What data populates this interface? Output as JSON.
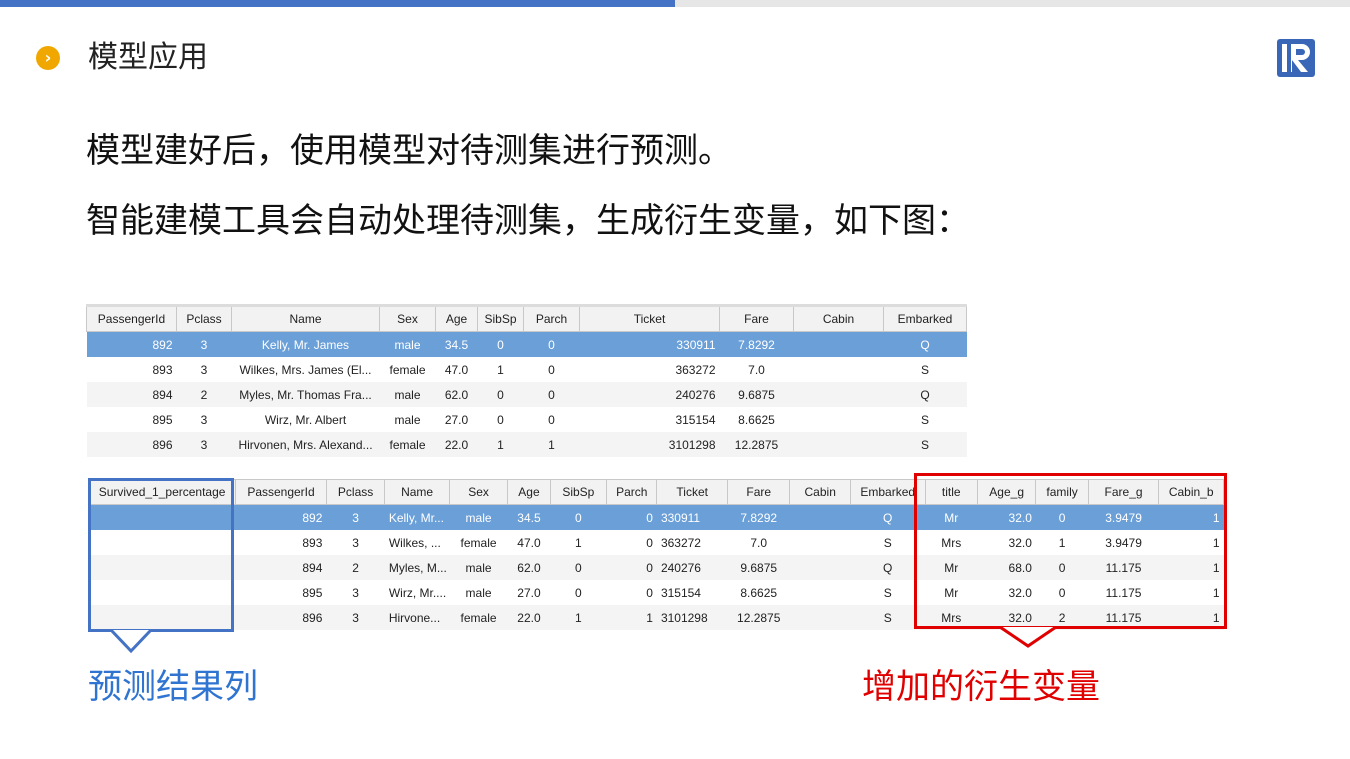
{
  "header": {
    "title": "模型应用",
    "bullet_glyph": "›"
  },
  "body_text": {
    "line1": "模型建好后，使用模型对待测集进行预测。",
    "line2": "智能建模工具会自动处理待测集，生成衍生变量，如下图："
  },
  "table_top": {
    "columns": [
      "PassengerId",
      "Pclass",
      "Name",
      "Sex",
      "Age",
      "SibSp",
      "Parch",
      "Ticket",
      "Fare",
      "Cabin",
      "Embarked"
    ],
    "rows": [
      [
        "892",
        "3",
        "Kelly, Mr. James",
        "male",
        "34.5",
        "0",
        "0",
        "330911",
        "7.8292",
        "",
        "Q"
      ],
      [
        "893",
        "3",
        "Wilkes, Mrs. James (El...",
        "female",
        "47.0",
        "1",
        "0",
        "363272",
        "7.0",
        "",
        "S"
      ],
      [
        "894",
        "2",
        "Myles, Mr. Thomas Fra...",
        "male",
        "62.0",
        "0",
        "0",
        "240276",
        "9.6875",
        "",
        "Q"
      ],
      [
        "895",
        "3",
        "Wirz, Mr. Albert",
        "male",
        "27.0",
        "0",
        "0",
        "315154",
        "8.6625",
        "",
        "S"
      ],
      [
        "896",
        "3",
        "Hirvonen, Mrs. Alexand...",
        "female",
        "22.0",
        "1",
        "1",
        "3101298",
        "12.2875",
        "",
        "S"
      ]
    ],
    "selected_row": 0
  },
  "table_bottom": {
    "columns": [
      "Survived_1_percentage",
      "PassengerId",
      "Pclass",
      "Name",
      "Sex",
      "Age",
      "SibSp",
      "Parch",
      "Ticket",
      "Fare",
      "Cabin",
      "Embarked",
      "title",
      "Age_g",
      "family",
      "Fare_g",
      "Cabin_b"
    ],
    "rows": [
      [
        "",
        "892",
        "3",
        "Kelly, Mr...",
        "male",
        "34.5",
        "0",
        "0",
        "330911",
        "7.8292",
        "",
        "Q",
        "Mr",
        "32.0",
        "0",
        "3.9479",
        "1"
      ],
      [
        "",
        "893",
        "3",
        "Wilkes, ...",
        "female",
        "47.0",
        "1",
        "0",
        "363272",
        "7.0",
        "",
        "S",
        "Mrs",
        "32.0",
        "1",
        "3.9479",
        "1"
      ],
      [
        "",
        "894",
        "2",
        "Myles, M...",
        "male",
        "62.0",
        "0",
        "0",
        "240276",
        "9.6875",
        "",
        "Q",
        "Mr",
        "68.0",
        "0",
        "11.175",
        "1"
      ],
      [
        "",
        "895",
        "3",
        "Wirz, Mr....",
        "male",
        "27.0",
        "0",
        "0",
        "315154",
        "8.6625",
        "",
        "S",
        "Mr",
        "32.0",
        "0",
        "11.175",
        "1"
      ],
      [
        "",
        "896",
        "3",
        "Hirvone...",
        "female",
        "22.0",
        "1",
        "1",
        "3101298",
        "12.2875",
        "",
        "S",
        "Mrs",
        "32.0",
        "2",
        "11.175",
        "1"
      ]
    ],
    "selected_row": 0
  },
  "annotations": {
    "prediction_label": "预测结果列",
    "derived_label": "增加的衍生变量"
  },
  "colors": {
    "accent_blue": "#4472c4",
    "accent_orange": "#f0a800",
    "highlight_red": "#e00000",
    "caption_blue": "#2f74d0",
    "selected_row": "#6a9fd8"
  }
}
